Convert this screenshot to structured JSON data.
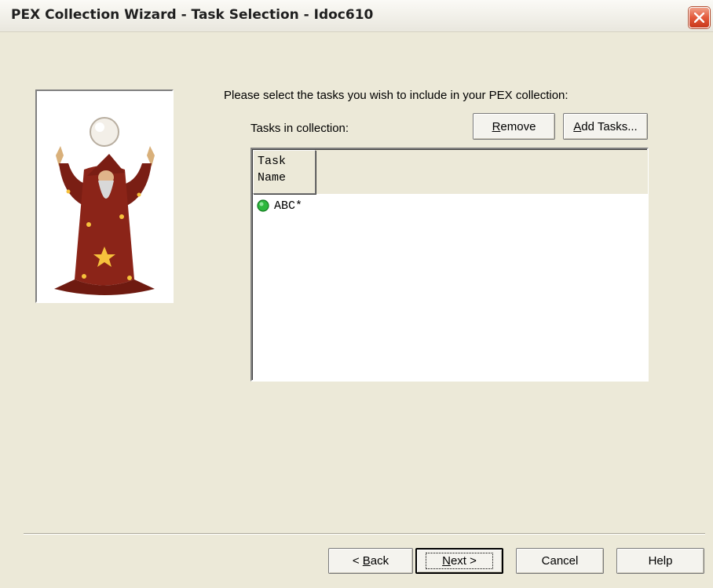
{
  "window": {
    "title": "PEX Collection Wizard - Task Selection - Idoc610",
    "close_icon": "close-icon"
  },
  "main": {
    "instruction": "Please select the tasks you wish to include in your PEX collection:",
    "tasks_label": "Tasks in collection:",
    "remove_button": {
      "mnemonic": "R",
      "rest": "emove"
    },
    "add_tasks_button": {
      "mnemonic": "A",
      "rest": "dd Tasks..."
    },
    "list": {
      "columns": [
        "Task Name"
      ],
      "column_lines": [
        "Task",
        "Name"
      ],
      "rows": [
        {
          "task_name": "ABC*",
          "status_icon": "green-status-icon"
        }
      ]
    }
  },
  "footer": {
    "back_button": {
      "prefix": "< ",
      "mnemonic": "B",
      "rest": "ack"
    },
    "next_button": {
      "mnemonic": "N",
      "rest": "ext >"
    },
    "cancel_button": "Cancel",
    "help_button": "Help"
  },
  "colors": {
    "dialog_bg": "#ece9d8",
    "close_red": "#e3593a",
    "status_green": "#2db83d"
  }
}
